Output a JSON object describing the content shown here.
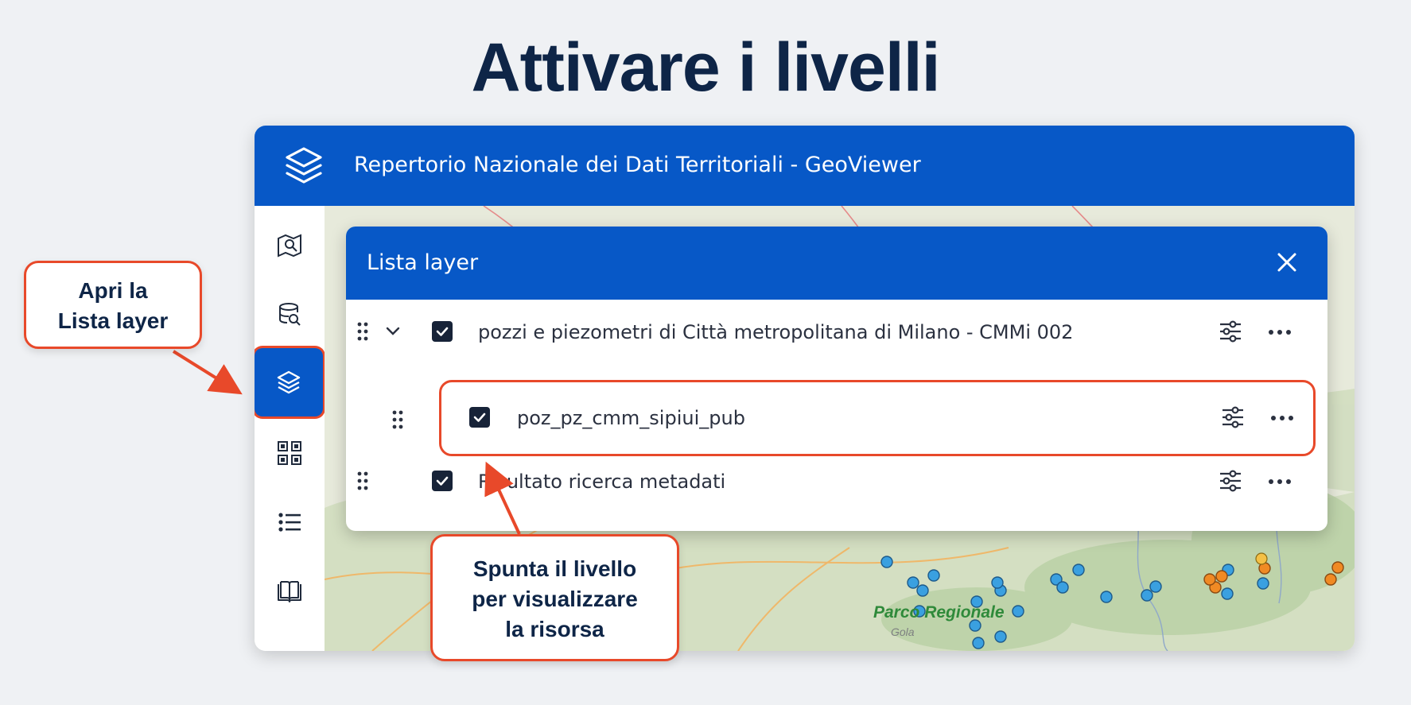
{
  "slide": {
    "title": "Attivare i livelli"
  },
  "app": {
    "title": "Repertorio Nazionale dei Dati Territoriali - GeoViewer",
    "logo_icon": "layers-icon",
    "header_color": "#0758c7"
  },
  "sidebar": {
    "items": [
      {
        "icon": "map-search-icon",
        "active": false
      },
      {
        "icon": "database-search-icon",
        "active": false
      },
      {
        "icon": "layers-icon",
        "active": true
      },
      {
        "icon": "qr-grid-icon",
        "active": false
      },
      {
        "icon": "list-icon",
        "active": false
      },
      {
        "icon": "book-icon",
        "active": false
      }
    ]
  },
  "map": {
    "label": "Parco Regionale",
    "label_2": "Gola"
  },
  "layer_panel": {
    "title": "Lista layer",
    "layers": [
      {
        "name": "pozzi e piezometri di Città metropolitana di Milano - CMMi 002",
        "checked": true,
        "expanded": true
      },
      {
        "name": "poz_pz_cmm_sipiui_pub",
        "checked": true,
        "highlighted": true
      },
      {
        "name": "Risultato ricerca metadati",
        "checked": true
      }
    ]
  },
  "callouts": {
    "open_list": [
      "Apri la",
      "Lista layer"
    ],
    "check_layer": [
      "Spunta il livello",
      "per visualizzare",
      "la risorsa"
    ]
  },
  "colors": {
    "accent": "#e8492a",
    "title": "#0e2547",
    "checkbox": "#172338"
  }
}
